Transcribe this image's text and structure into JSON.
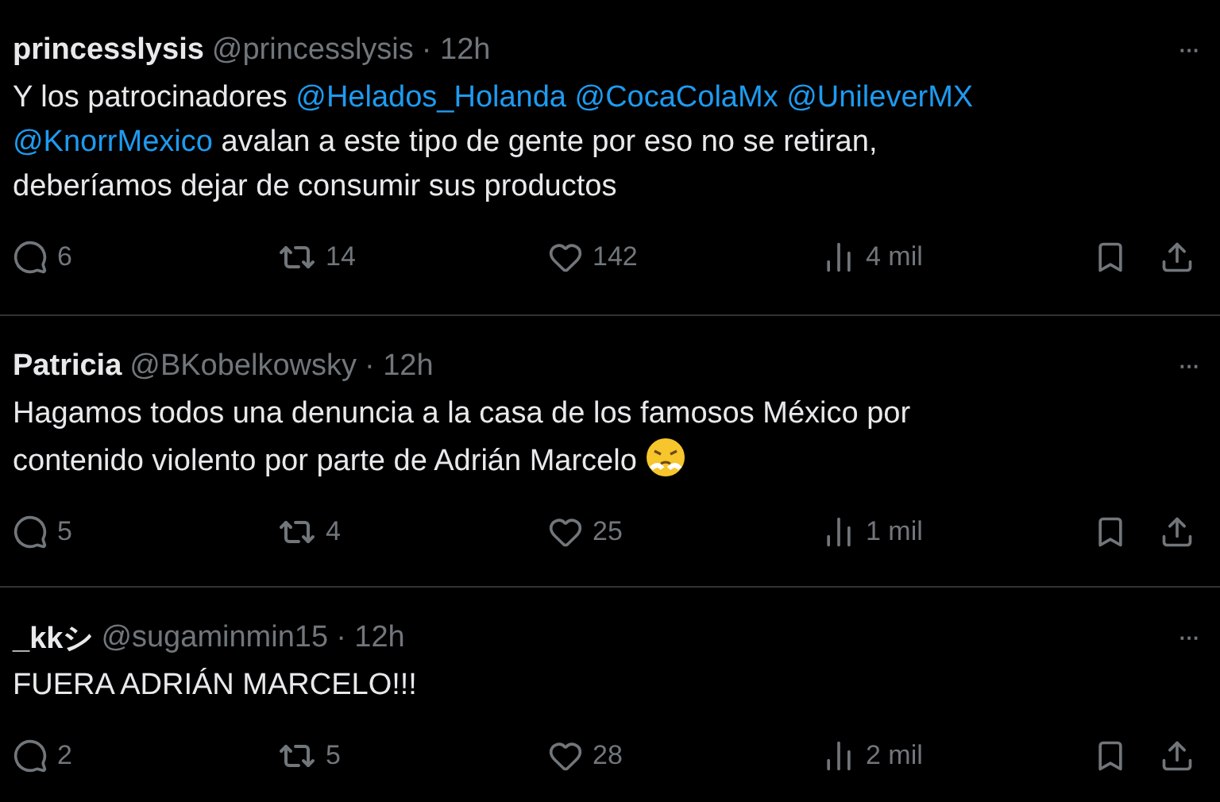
{
  "tweets": [
    {
      "name": "princesslysis",
      "handle": "@princesslysis",
      "time": "· 12h",
      "more": "···",
      "body": [
        {
          "kind": "text",
          "text": "Y los patrocinadores"
        },
        {
          "kind": "mention",
          "text": "@Helados_Holanda"
        },
        {
          "kind": "mention",
          "text": "@CocaColaMx"
        },
        {
          "kind": "mention",
          "text": "@UnileverMX"
        },
        {
          "kind": "mention",
          "text": "@KnorrMexico"
        },
        {
          "kind": "text",
          "text": "avalan a este tipo de gente por eso no se retiran, deberíamos dejar de consumir sus productos"
        }
      ],
      "replies": "6",
      "reposts": "14",
      "likes": "142",
      "views": "4 mil"
    },
    {
      "name": "Patricia",
      "handle": "@BKobelkowsky",
      "time": "· 12h",
      "more": "···",
      "body": [
        {
          "kind": "text",
          "text": "Hagamos todos una denuncia a la casa de los famosos México por contenido violento por parte de Adrián Marcelo"
        },
        {
          "kind": "emoji"
        }
      ],
      "replies": "5",
      "reposts": "4",
      "likes": "25",
      "views": "1 mil"
    },
    {
      "name": "_kkシ",
      "handle": "@sugaminmin15",
      "time": "· 12h",
      "more": "···",
      "body": [
        {
          "kind": "text",
          "text": "FUERA ADRIÁN MARCELO!!!"
        }
      ],
      "replies": "2",
      "reposts": "5",
      "likes": "28",
      "views": "2 mil"
    }
  ]
}
